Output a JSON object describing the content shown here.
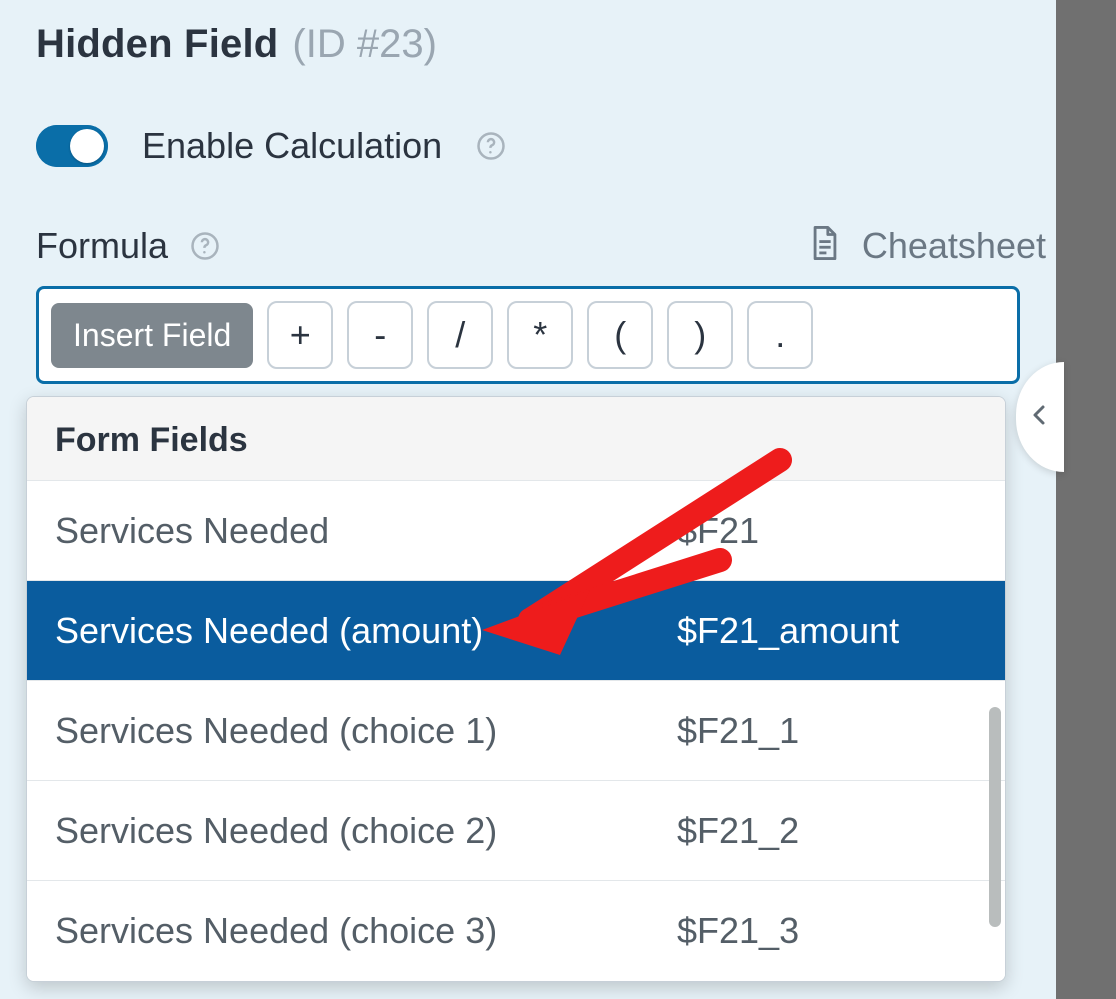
{
  "header": {
    "title": "Hidden Field",
    "id_label": "(ID #23)"
  },
  "toggle": {
    "label": "Enable Calculation",
    "on": true
  },
  "formula": {
    "label": "Formula",
    "cheatsheet_label": "Cheatsheet",
    "insert_label": "Insert Field",
    "operators": [
      "+",
      "-",
      "/",
      "*",
      "(",
      ")",
      "."
    ]
  },
  "dropdown": {
    "header": "Form Fields",
    "selected_index": 1,
    "rows": [
      {
        "label": "Services Needed",
        "code": "$F21"
      },
      {
        "label": "Services Needed (amount)",
        "code": "$F21_amount"
      },
      {
        "label": "Services Needed (choice 1)",
        "code": "$F21_1"
      },
      {
        "label": "Services Needed (choice 2)",
        "code": "$F21_2"
      },
      {
        "label": "Services Needed (choice 3)",
        "code": "$F21_3"
      }
    ]
  }
}
